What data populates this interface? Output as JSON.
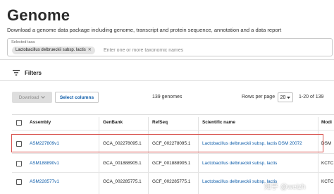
{
  "page": {
    "title": "Genome",
    "description": "Download a genome data package including genome, transcript and protein sequence, annotation and a data report"
  },
  "taxa": {
    "label": "Selected taxa",
    "chip": "Lactobacillus delbrueckii subsp. lactis",
    "placeholder": "Enter one or more taxonomic names"
  },
  "filters": {
    "label": "Filters"
  },
  "toolbar": {
    "download_label": "Download",
    "select_columns_label": "Select columns",
    "genome_count": "139 genomes",
    "rows_per_page_label": "Rows per page",
    "rows_per_page_value": "20",
    "range": "1-20 of 139"
  },
  "table": {
    "headers": [
      "Assembly",
      "GenBank",
      "RefSeq",
      "Scientific name",
      "Modi"
    ],
    "rows": [
      {
        "assembly": "ASM227809v1",
        "genbank": "GCA_002278095.1",
        "refseq": "GCF_002278095.1",
        "scientific_name": "Lactobacillus delbrueckii subsp. lactis DSM 20072",
        "extra": "DSM"
      },
      {
        "assembly": "ASM188890v1",
        "genbank": "GCA_001888905.1",
        "refseq": "GCF_001888905.1",
        "scientific_name": "Lactobacillus delbrueckii subsp. lactis",
        "extra": "KCTC"
      },
      {
        "assembly": "ASM228577v1",
        "genbank": "GCA_002285775.1",
        "refseq": "GCF_002285775.1",
        "scientific_name": "Lactobacillus delbrueckii subsp. lactis",
        "extra": "KCTC"
      }
    ]
  },
  "watermark": {
    "text": "知乎 @weizh"
  },
  "colors": {
    "link": "#0a5aa8",
    "highlight": "#d9534f",
    "disabled_button": "#dedede"
  }
}
